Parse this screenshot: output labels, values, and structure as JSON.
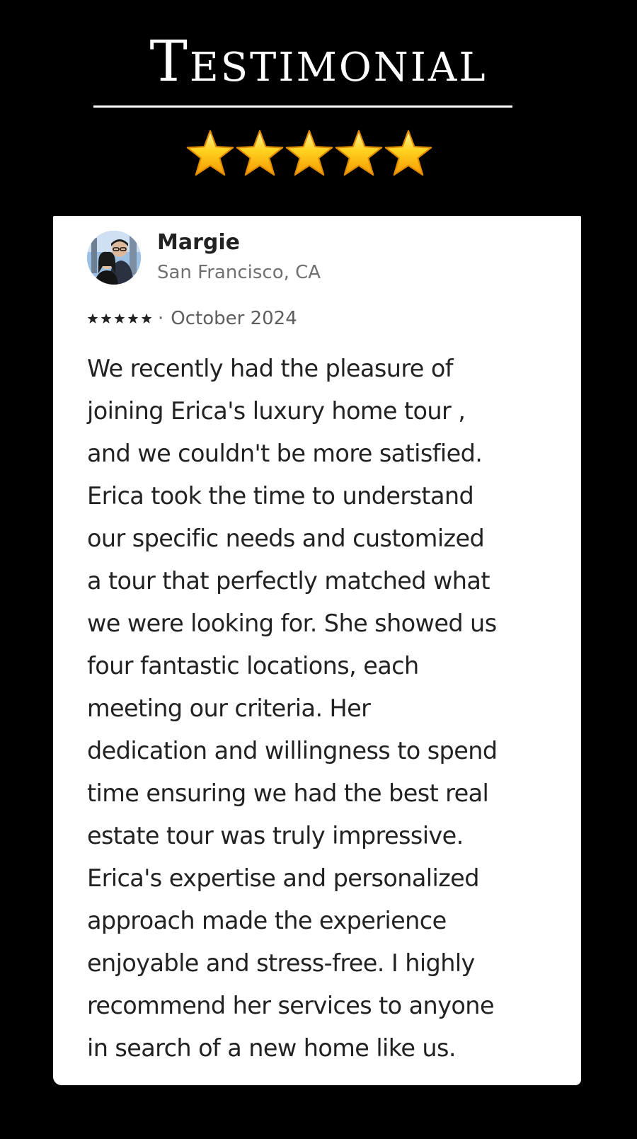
{
  "header": {
    "title": "Testimonial",
    "rating_stars": 5
  },
  "review": {
    "reviewer_name": "Margie",
    "reviewer_location": "San Francisco, CA",
    "rating": 5,
    "separator": "·",
    "date": "October 2024",
    "body": "We recently had the pleasure of\njoining Erica's luxury home tour ,\nand we couldn't be more satisfied.\nErica took the time to understand\nour specific needs and customized\na tour that perfectly matched what\nwe were looking for. She showed us\nfour fantastic locations, each\nmeeting our criteria. Her\ndedication and willingness to spend\ntime ensuring we had the best real\nestate tour was truly impressive.\nErica's expertise and personalized\napproach made the experience\nenjoyable and stress-free. I highly\nrecommend her services to anyone\nin search of a new home like us."
  },
  "colors": {
    "background": "#000000",
    "card": "#ffffff",
    "star_gold": "#ffc21a",
    "text_primary": "#222222",
    "text_secondary": "#717171"
  },
  "icons": {
    "big_star": "star-icon",
    "mini_star": "star-icon",
    "avatar": "avatar"
  }
}
